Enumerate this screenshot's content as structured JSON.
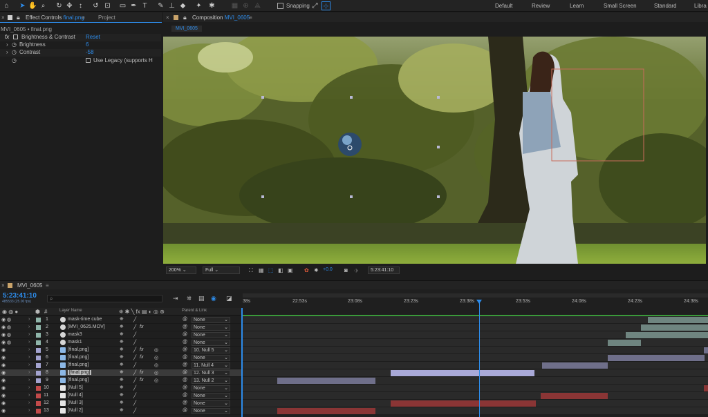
{
  "toolbar": {
    "snapping_label": "Snapping",
    "workspaces": [
      "Default",
      "Review",
      "Learn",
      "Small Screen",
      "Standard",
      "Libra"
    ]
  },
  "effect_controls": {
    "tab_prefix": "Effect Controls",
    "tab_file": "final.png",
    "project_tab": "Project",
    "breadcrumb": "MVI_0605 • final.png",
    "effect_name": "Brightness & Contrast",
    "reset_label": "Reset",
    "brightness_label": "Brightness",
    "brightness_value": "6",
    "contrast_label": "Contrast",
    "contrast_value": "-58",
    "legacy_label": "Use Legacy (supports H"
  },
  "composition": {
    "tab_prefix": "Composition",
    "tab_name": "MVI_0605",
    "subtab": "MVI_0605",
    "zoom": "200%",
    "resolution": "Full",
    "exposure": "+0.0",
    "timecode": "5:23:41:10"
  },
  "timeline": {
    "tab": "MVI_0605",
    "timecode": "5:23:41:10",
    "frame_info": "485533 (25.00 fps)",
    "search_placeholder": "",
    "col_number": "#",
    "col_layer_name": "Layer Name",
    "col_parent": "Parent & Link",
    "ruler": [
      "38s",
      "22:53s",
      "23:08s",
      "23:23s",
      "23:38s",
      "23:53s",
      "24:08s",
      "24:23s",
      "24:38s"
    ],
    "layers": [
      {
        "num": "1",
        "name": "mask-time cube",
        "color": "#8fb5aa",
        "parent": "None",
        "fx": false
      },
      {
        "num": "2",
        "name": "[MVI_0625.MOV]",
        "color": "#8fb5aa",
        "parent": "None",
        "fx": true
      },
      {
        "num": "3",
        "name": "mask3",
        "color": "#8fb5aa",
        "parent": "None",
        "fx": false
      },
      {
        "num": "4",
        "name": "mask1",
        "color": "#8fb5aa",
        "parent": "None",
        "fx": false
      },
      {
        "num": "5",
        "name": "[final.png]",
        "color": "#a3a3cf",
        "parent": "10. Null 5",
        "fx": true
      },
      {
        "num": "6",
        "name": "[final.png]",
        "color": "#a3a3cf",
        "parent": "None",
        "fx": true
      },
      {
        "num": "7",
        "name": "[final.png]",
        "color": "#a3a3cf",
        "parent": "11. Null 4",
        "fx": false
      },
      {
        "num": "8",
        "name": "[final.png]",
        "color": "#a3a3cf",
        "parent": "12. Null 3",
        "fx": true
      },
      {
        "num": "9",
        "name": "[final.png]",
        "color": "#a3a3cf",
        "parent": "13. Null 2",
        "fx": true
      },
      {
        "num": "10",
        "name": "[Null 5]",
        "color": "#c24a4a",
        "parent": "None",
        "fx": false
      },
      {
        "num": "11",
        "name": "[Null 4]",
        "color": "#c24a4a",
        "parent": "None",
        "fx": false
      },
      {
        "num": "12",
        "name": "[Null 3]",
        "color": "#c24a4a",
        "parent": "None",
        "fx": false
      },
      {
        "num": "13",
        "name": "[Null 2]",
        "color": "#c24a4a",
        "parent": "None",
        "fx": false
      }
    ]
  },
  "colors": {
    "accent": "#2d8ceb",
    "null_bar": "#8a3535",
    "png_bar": "#6f6f8a",
    "mask_bar": "#6f8580"
  }
}
